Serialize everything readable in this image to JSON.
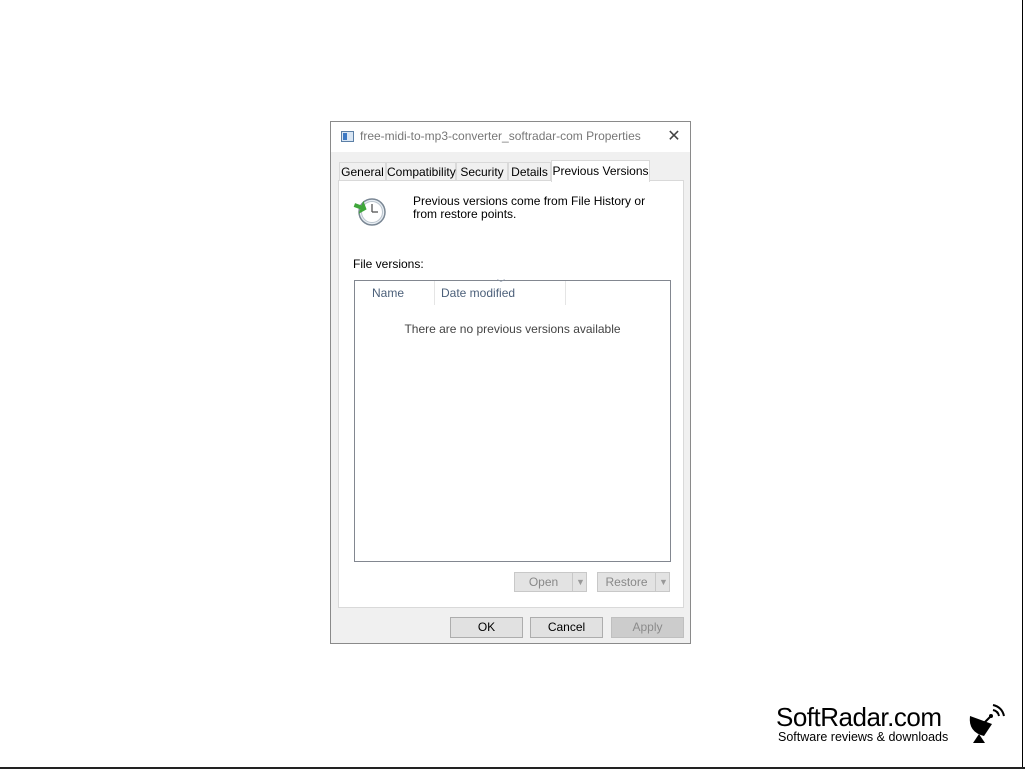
{
  "dialog": {
    "title": "free-midi-to-mp3-converter_softradar-com Properties",
    "close_glyph": "✕"
  },
  "tabs": [
    {
      "label": "General"
    },
    {
      "label": "Compatibility"
    },
    {
      "label": "Security"
    },
    {
      "label": "Details"
    },
    {
      "label": "Previous Versions",
      "active": true
    }
  ],
  "panel": {
    "description": "Previous versions come from File History or from restore points.",
    "file_versions_label": "File versions:",
    "columns": [
      "Name",
      "Date modified"
    ],
    "empty_message": "There are no previous versions available",
    "open_label": "Open",
    "restore_label": "Restore"
  },
  "buttons": {
    "ok": "OK",
    "cancel": "Cancel",
    "apply": "Apply"
  },
  "watermark": {
    "brand": "SoftRadar.com",
    "tagline": "Software reviews & downloads"
  },
  "icons": {
    "title": "file-properties-icon",
    "history": "previous-versions-clock-icon",
    "logo": "satellite-dish-icon"
  }
}
